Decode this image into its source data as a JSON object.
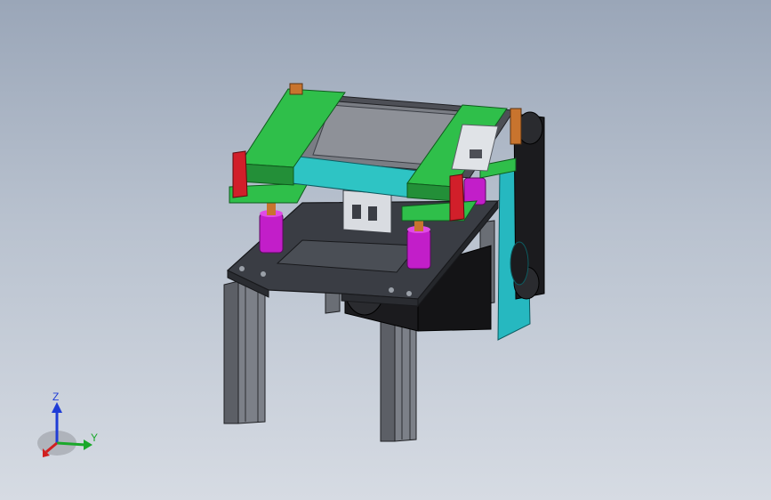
{
  "viewport": {
    "background_top": "#9aa6b8",
    "background_bottom": "#d6dbe3"
  },
  "model": {
    "frame_color": "#3a3d44",
    "belt_color": "#4d4f56",
    "roller_color": "#2ec4c4",
    "bracket_color": "#2fbf4a",
    "standoff_color": "#c21ec9",
    "clamp_color": "#d11f2a",
    "motor_color": "#1b1b1e",
    "side_plate_color": "#26b8c0",
    "nut_color": "#c8742e"
  },
  "triad": {
    "z_label": "Z",
    "y_label": "Y",
    "z_color": "#1f3dd6",
    "y_color": "#1aa82a",
    "x_color": "#d11f1f"
  }
}
